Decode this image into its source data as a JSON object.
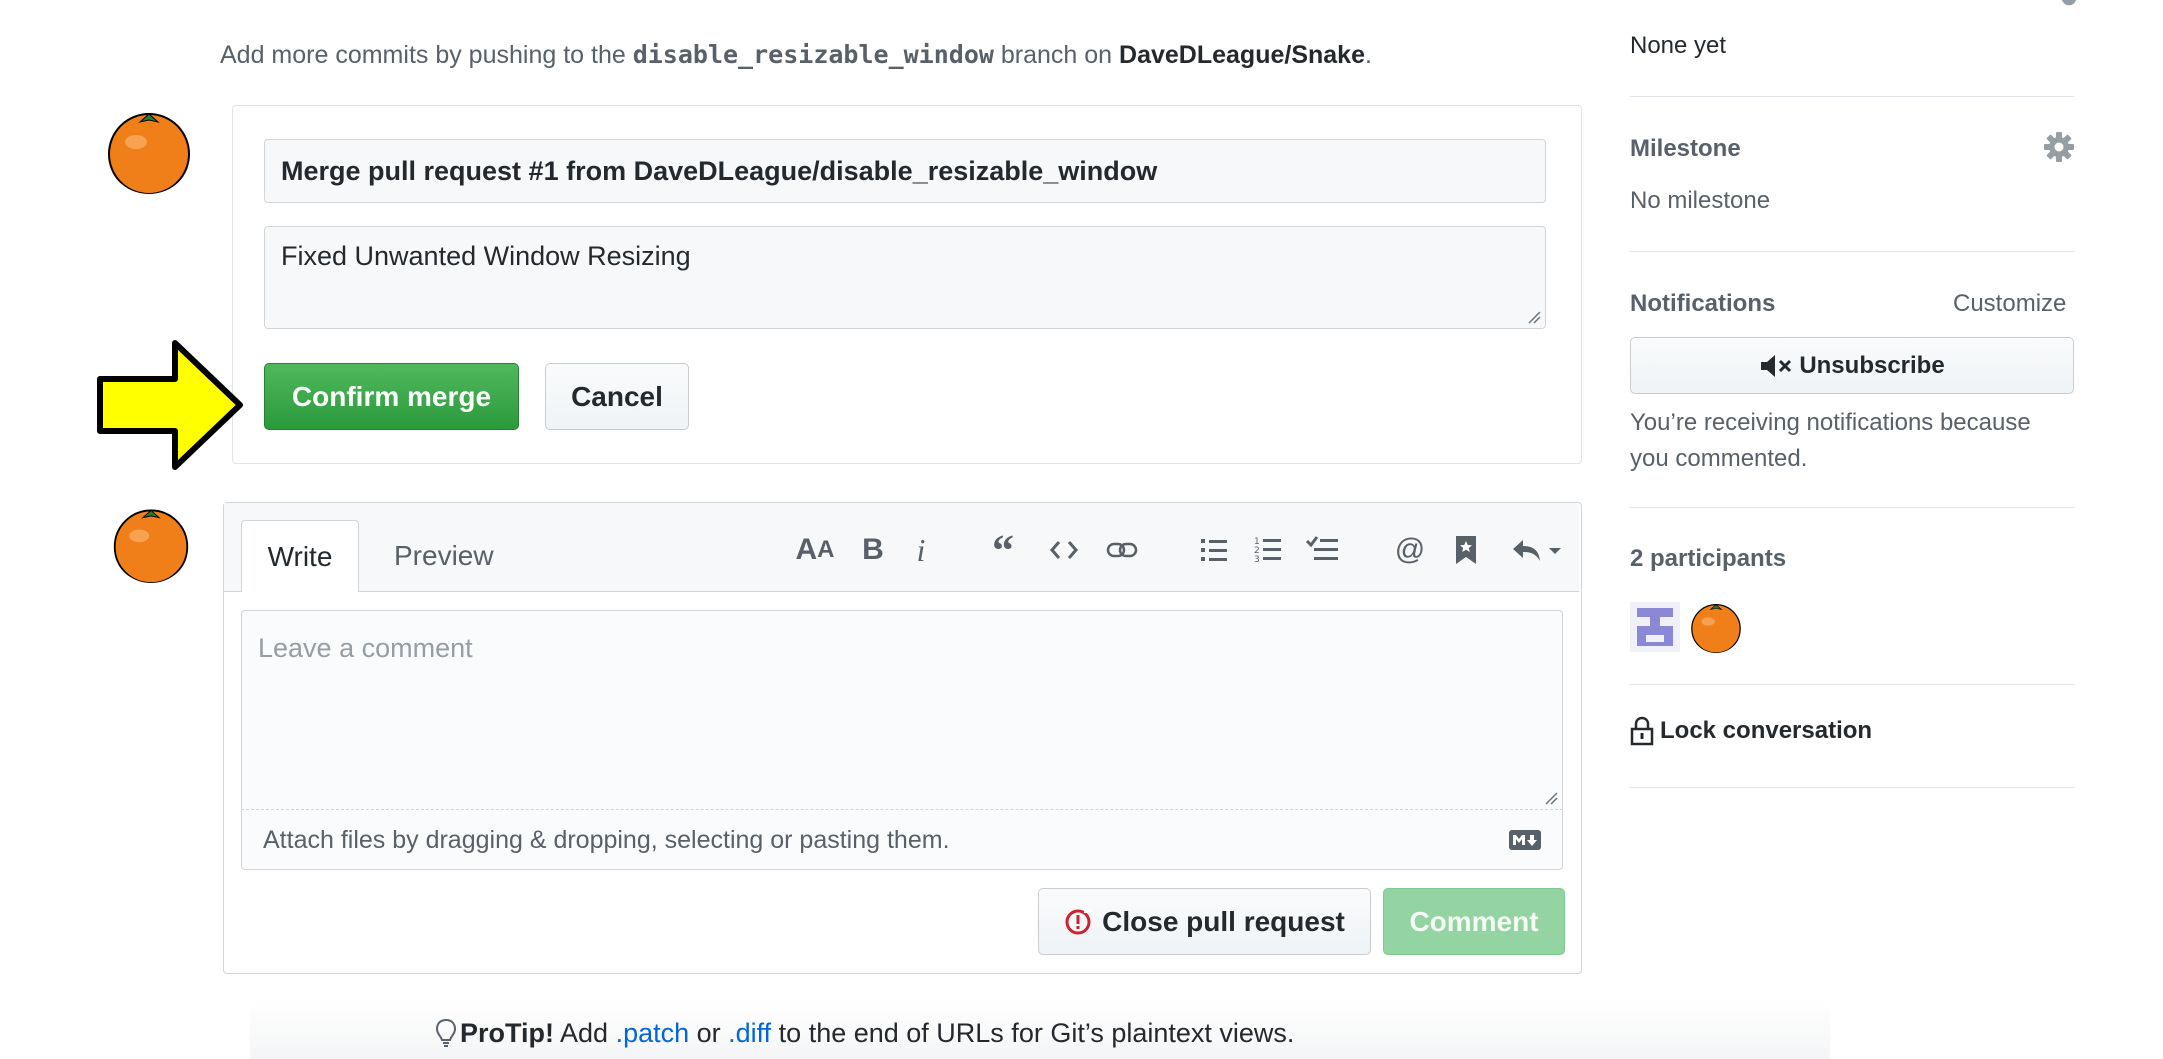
{
  "merge_hint": {
    "prefix": "Add more commits by pushing to the ",
    "branch": "disable_resizable_window",
    "middle": " branch on ",
    "repo": "DaveDLeague/Snake",
    "suffix": "."
  },
  "merge_form": {
    "title_value": "Merge pull request #1 from DaveDLeague/disable_resizable_window",
    "body_value": "Fixed Unwanted Window Resizing",
    "confirm_label": "Confirm merge",
    "cancel_label": "Cancel"
  },
  "comment_form": {
    "tab_write": "Write",
    "tab_preview": "Preview",
    "placeholder": "Leave a comment",
    "attach_hint": "Attach files by dragging & dropping, selecting or pasting them.",
    "close_label": "Close pull request",
    "comment_label": "Comment",
    "toolbar": [
      "text-size-icon",
      "bold-icon",
      "italic-icon",
      "quote-icon",
      "code-icon",
      "link-icon",
      "bulleted-list-icon",
      "numbered-list-icon",
      "task-list-icon",
      "mention-icon",
      "saved-reply-icon",
      "reply-icon"
    ]
  },
  "protip": {
    "label": "ProTip!",
    "text1": " Add ",
    "link1": ".patch",
    "text2": " or ",
    "link2": ".diff",
    "text3": " to the end of URLs for Git’s plaintext views."
  },
  "sidebar": {
    "projects_value": "None yet",
    "milestone_heading": "Milestone",
    "milestone_value": "No milestone",
    "notifications_heading": "Notifications",
    "customize_label": "Customize",
    "unsubscribe_label": "Unsubscribe",
    "notifications_reason": "You’re receiving notifications because you commented.",
    "participants_heading": "2 participants",
    "lock_label": "Lock conversation"
  },
  "colors": {
    "accent_green": "#2ea44f",
    "link_blue": "#0366d6",
    "arrow_yellow": "#ffff00",
    "avatar_orange": "#f07f1a"
  }
}
